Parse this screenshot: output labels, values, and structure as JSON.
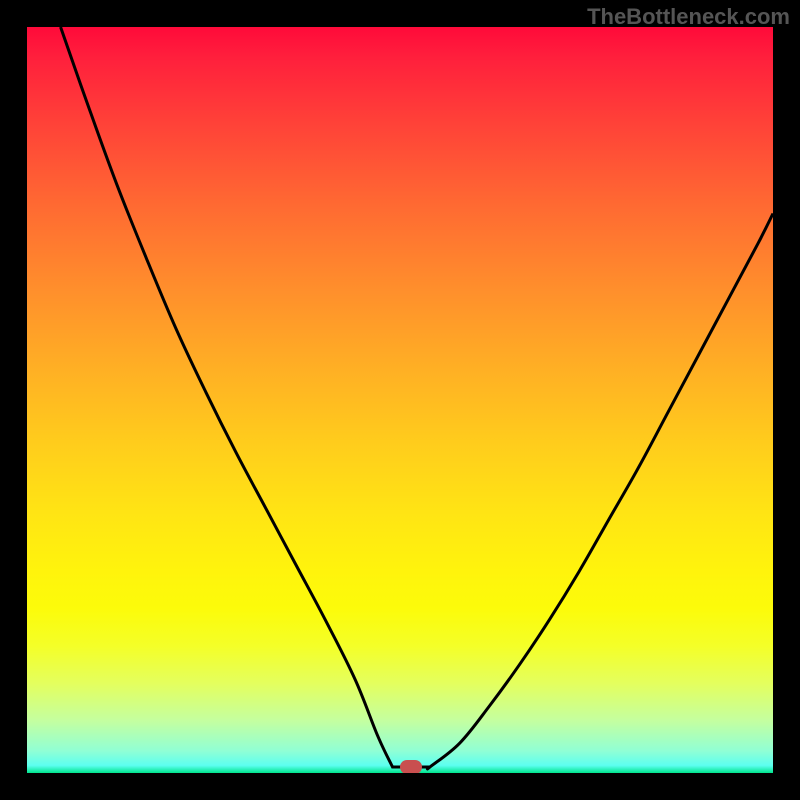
{
  "watermark": "TheBottleneck.com",
  "chart_data": {
    "type": "line",
    "title": "",
    "xlabel": "",
    "ylabel": "",
    "xlim": [
      0,
      100
    ],
    "ylim": [
      0,
      100
    ],
    "background": "red-yellow-green vertical gradient",
    "series": [
      {
        "name": "left-branch",
        "x": [
          4.5,
          8,
          12,
          16,
          20,
          24,
          28,
          32,
          36,
          40,
          44,
          47,
          49
        ],
        "y": [
          100,
          90,
          79,
          69,
          59.5,
          51,
          43,
          35.5,
          28,
          20.5,
          12.5,
          5,
          0.8
        ]
      },
      {
        "name": "right-branch",
        "x": [
          54,
          58,
          62,
          66,
          70,
          74,
          78,
          82,
          86,
          90,
          94,
          98,
          100
        ],
        "y": [
          0.8,
          4,
          9,
          14.5,
          20.5,
          27,
          34,
          41,
          48.5,
          56,
          63.5,
          71,
          75
        ]
      }
    ],
    "marker": {
      "x": 51.5,
      "y": 0.8
    },
    "flat_bottom": {
      "x_from": 49,
      "x_to": 54,
      "y": 0.8
    }
  },
  "colors": {
    "curve": "#000000",
    "marker": "#c94f4f",
    "frame": "#000000"
  }
}
